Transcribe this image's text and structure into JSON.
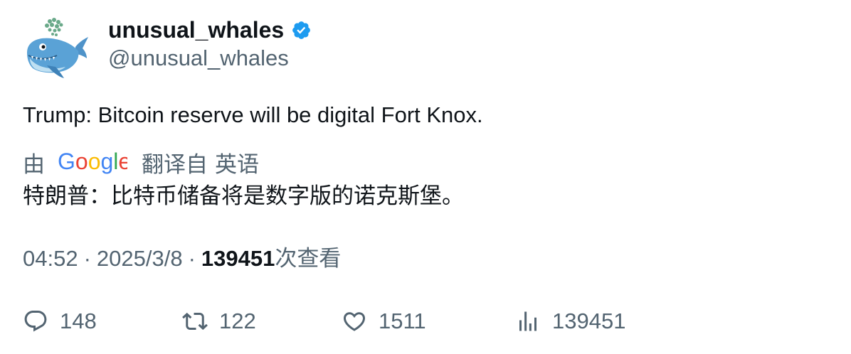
{
  "author": {
    "display_name": "unusual_whales",
    "handle": "@unusual_whales",
    "verified": true,
    "verified_color": "#1d9bf0"
  },
  "tweet": {
    "text": "Trump: Bitcoin reserve will be digital Fort Knox.",
    "translation": {
      "by_prefix": "由",
      "provider": "Google",
      "translated_from": "翻译自",
      "language": "英语",
      "text": "特朗普：比特币储备将是数字版的诺克斯堡。"
    },
    "meta": {
      "time": "04:52",
      "separator": "·",
      "date": "2025/3/8",
      "views_count": "139451",
      "views_label": "次查看"
    }
  },
  "actions": {
    "reply_count": "148",
    "retweet_count": "122",
    "like_count": "1511",
    "views_count": "139451"
  },
  "icons": {
    "reply": "reply-icon",
    "retweet": "retweet-icon",
    "like": "heart-icon",
    "views": "analytics-icon",
    "verified": "verified-badge-icon"
  },
  "colors": {
    "text_primary": "#0f1419",
    "text_secondary": "#536471",
    "google_blue": "#4285F4",
    "google_red": "#EA4335",
    "google_yellow": "#FBBC05",
    "google_green": "#34A853"
  }
}
